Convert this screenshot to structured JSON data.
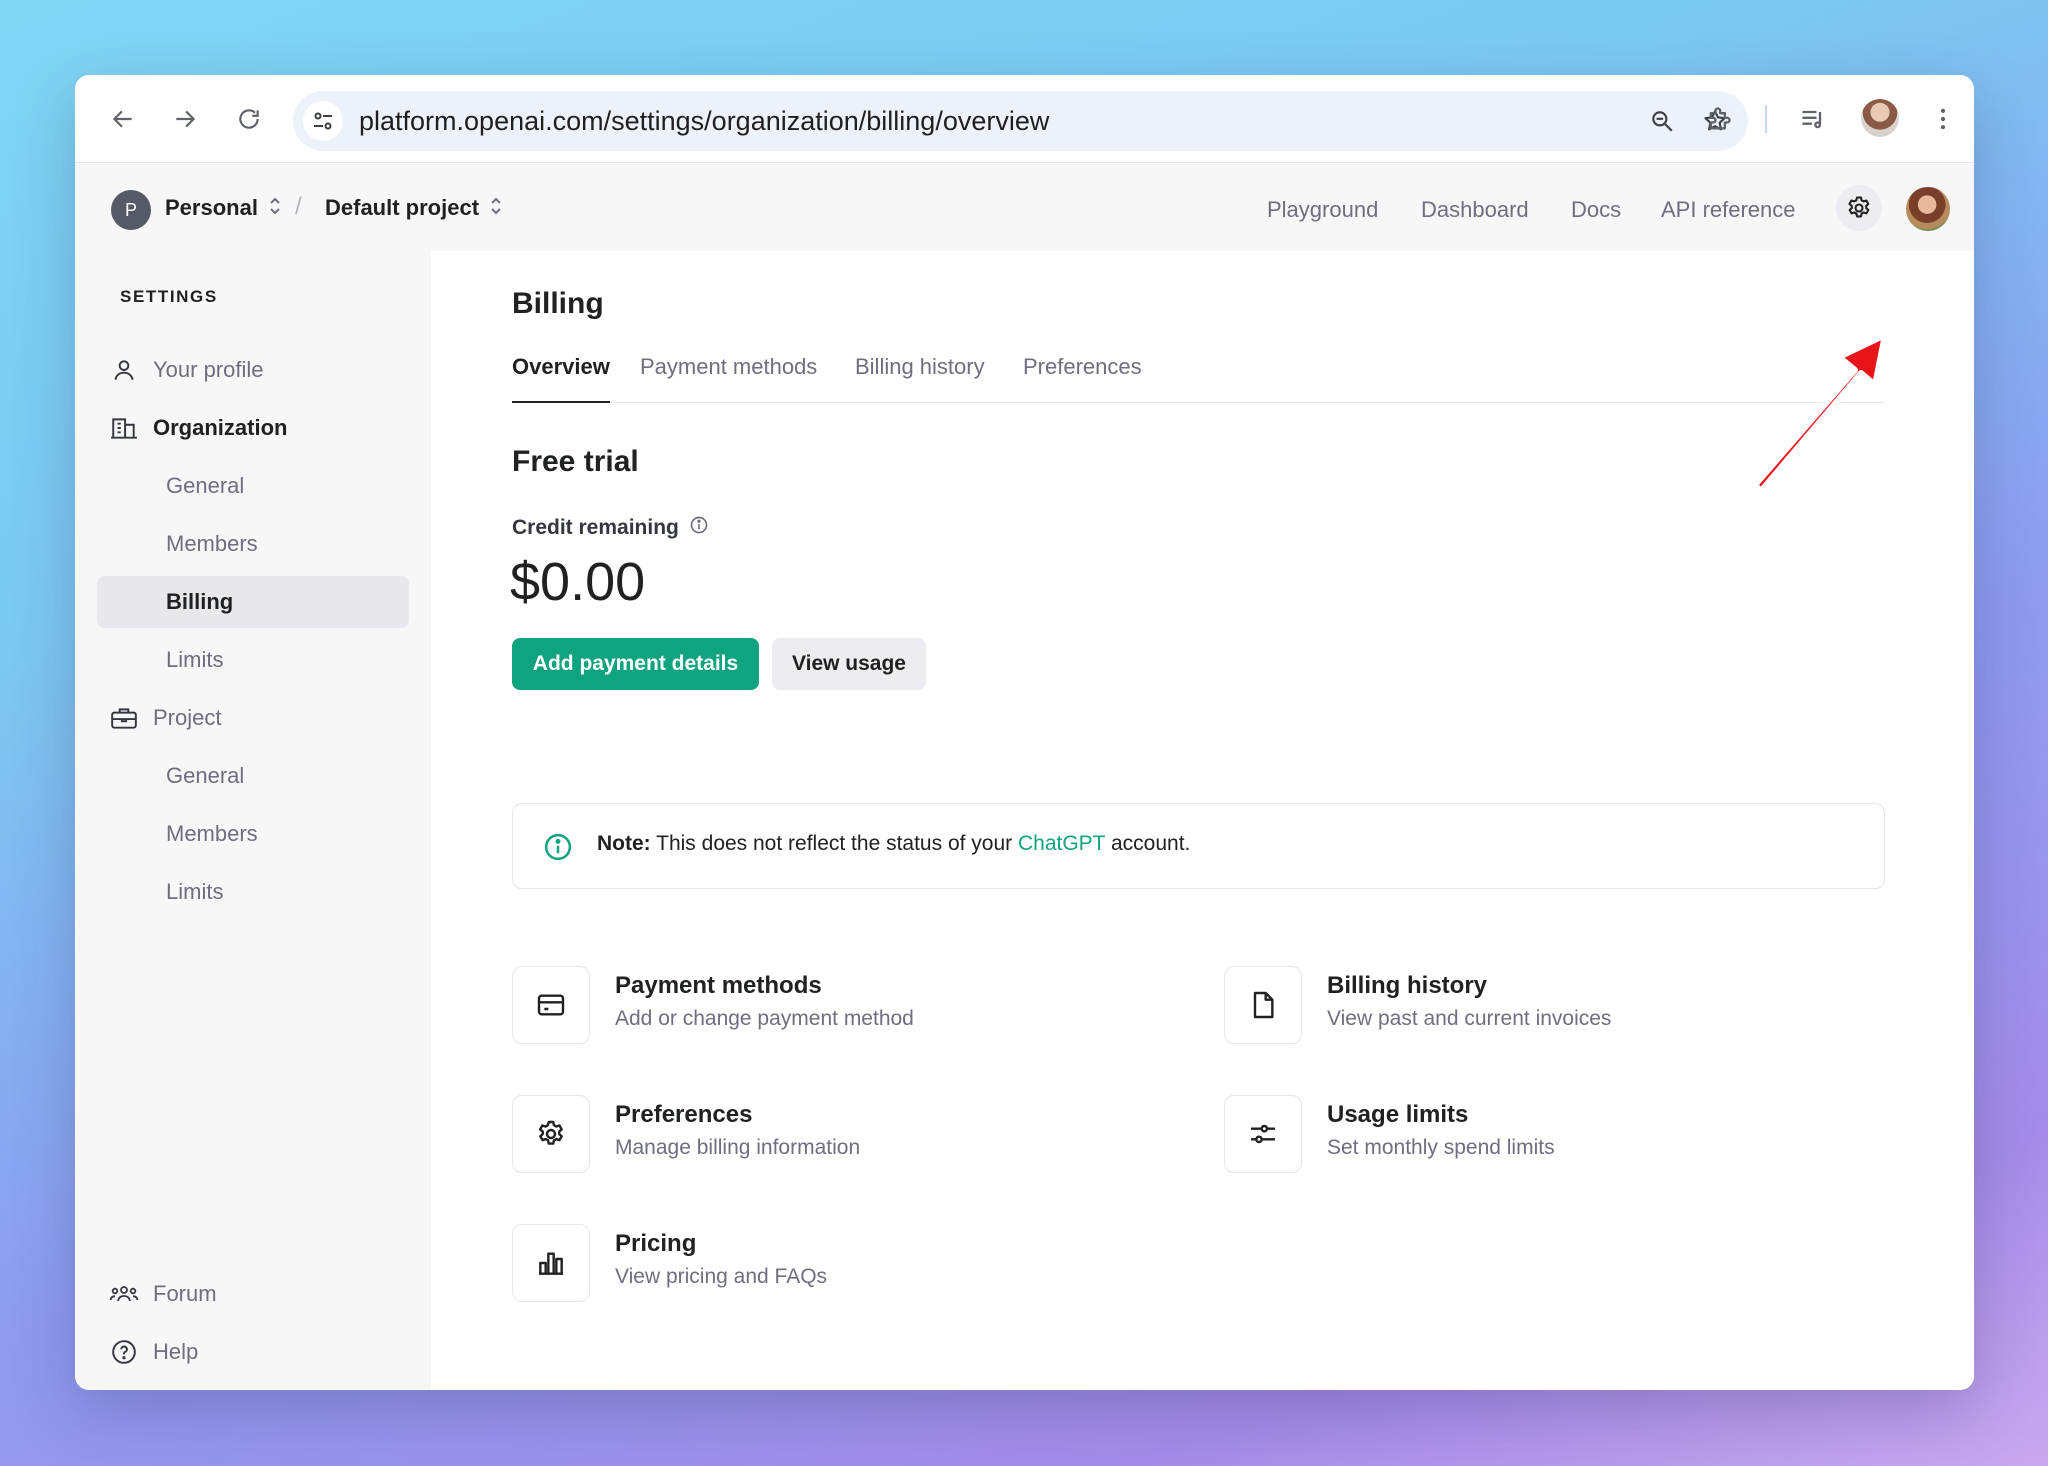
{
  "browser": {
    "url": "platform.openai.com/settings/organization/billing/overview",
    "icons": [
      "back-arrow-icon",
      "forward-arrow-icon",
      "reload-icon",
      "site-settings-icon",
      "zoom-icon",
      "bookmark-star-icon",
      "extensions-icon",
      "media-controls-icon",
      "profile-avatar",
      "kebab-menu-icon"
    ]
  },
  "header": {
    "org_initial": "P",
    "org_name": "Personal",
    "project_name": "Default project",
    "separator": "/",
    "nav": [
      "Playground",
      "Dashboard",
      "Docs",
      "API reference"
    ]
  },
  "sidebar": {
    "heading": "SETTINGS",
    "your_profile": "Your profile",
    "organization": "Organization",
    "org_items": [
      "General",
      "Members",
      "Billing",
      "Limits"
    ],
    "project": "Project",
    "project_items": [
      "General",
      "Members",
      "Limits"
    ],
    "forum": "Forum",
    "help": "Help"
  },
  "main": {
    "title": "Billing",
    "tabs": [
      "Overview",
      "Payment methods",
      "Billing history",
      "Preferences"
    ],
    "active_tab": "Overview",
    "plan": "Free trial",
    "credit_label": "Credit remaining",
    "credit_value": "$0.00",
    "primary_button": "Add payment details",
    "secondary_button": "View usage",
    "note": {
      "bold": "Note:",
      "text_before": " This does not reflect the status of your ",
      "link": "ChatGPT",
      "text_after": " account."
    },
    "cards": [
      {
        "title": "Payment methods",
        "desc": "Add or change payment method",
        "icon": "credit-card-icon"
      },
      {
        "title": "Billing history",
        "desc": "View past and current invoices",
        "icon": "document-icon"
      },
      {
        "title": "Preferences",
        "desc": "Manage billing information",
        "icon": "gear-icon"
      },
      {
        "title": "Usage limits",
        "desc": "Set monthly spend limits",
        "icon": "sliders-icon"
      },
      {
        "title": "Pricing",
        "desc": "View pricing and FAQs",
        "icon": "bar-chart-icon"
      }
    ]
  },
  "colors": {
    "accent": "#10a37f",
    "annotation_arrow": "#e8141a"
  }
}
